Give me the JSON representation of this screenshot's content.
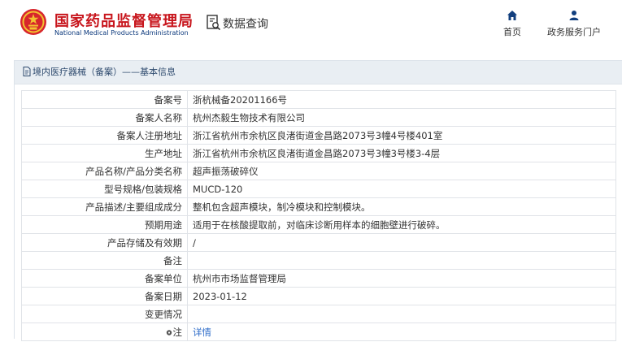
{
  "header": {
    "title_cn": "国家药品监督管理局",
    "title_en": "National Medical Products Administration",
    "query_label": "数据查询",
    "nav": [
      {
        "label": "首页",
        "icon": "home-icon"
      },
      {
        "label": "政务服务门户",
        "icon": "user-icon"
      }
    ]
  },
  "panel": {
    "title": "境内医疗器械（备案）——基本信息",
    "rows": [
      {
        "label": "备案号",
        "value": "浙杭械备20201166号"
      },
      {
        "label": "备案人名称",
        "value": "杭州杰毅生物技术有限公司"
      },
      {
        "label": "备案人注册地址",
        "value": "浙江省杭州市余杭区良渚街道金昌路2073号3幢4号楼401室"
      },
      {
        "label": "生产地址",
        "value": "浙江省杭州市余杭区良渚街道金昌路2073号3幢3号楼3-4层"
      },
      {
        "label": "产品名称/产品分类名称",
        "value": "超声振荡破碎仪"
      },
      {
        "label": "型号规格/包装规格",
        "value": "MUCD-120"
      },
      {
        "label": "产品描述/主要组成成分",
        "value": "整机包含超声模块，制冷模块和控制模块。"
      },
      {
        "label": "预期用途",
        "value": "适用于在核酸提取前，对临床诊断用样本的细胞壁进行破碎。"
      },
      {
        "label": "产品存储及有效期",
        "value": "/"
      },
      {
        "label": "备注",
        "value": ""
      },
      {
        "label": "备案单位",
        "value": "杭州市市场监督管理局"
      },
      {
        "label": "备案日期",
        "value": "2023-01-12"
      },
      {
        "label": "变更情况",
        "value": ""
      }
    ],
    "note_label": "注",
    "note_link": "详情"
  },
  "colors": {
    "brand_red": "#c8161d",
    "brand_blue": "#0d3a7d",
    "link_blue": "#2f6dc9",
    "panel_head_bg": "#e9eef3"
  }
}
